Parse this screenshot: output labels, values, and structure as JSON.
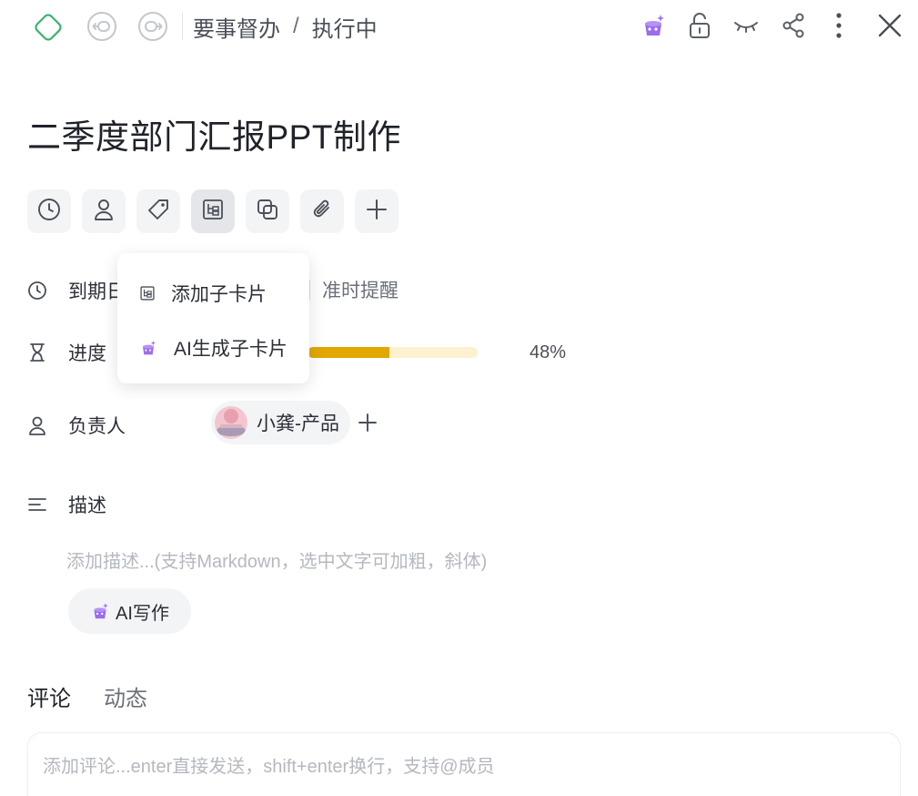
{
  "header": {
    "breadcrumb_parent": "要事督办",
    "breadcrumb_sep": "/",
    "breadcrumb_current": "执行中",
    "icons": [
      "diamond-icon",
      "back-icon",
      "forward-icon",
      "ai-wand-icon",
      "unlock-icon",
      "eye-closed-icon",
      "share-icon",
      "more-icon",
      "close-icon"
    ]
  },
  "task": {
    "title": "二季度部门汇报PPT制作"
  },
  "toolbar": {
    "icons": [
      "clock-icon",
      "user-icon",
      "tag-icon",
      "subcard-icon",
      "copy-icon",
      "attachment-icon",
      "plus-icon"
    ]
  },
  "properties": {
    "due_label": "到期日",
    "remind_label": "准时提醒",
    "progress_label": "进度",
    "progress_value": 48,
    "progress_text": "48%",
    "assignee_label": "负责人",
    "assignee_name": "小龚-产品"
  },
  "description": {
    "label": "描述",
    "placeholder": "添加描述...(支持Markdown，选中文字可加粗，斜体)",
    "ai_button": "AI写作"
  },
  "tabs": [
    "评论",
    "动态"
  ],
  "comment": {
    "placeholder": "添加评论...enter直接发送，shift+enter换行，支持@成员"
  },
  "popup": {
    "items": [
      {
        "label": "添加子卡片",
        "icon": "subcard-icon"
      },
      {
        "label": "AI生成子卡片",
        "icon": "ai-wand-icon"
      }
    ]
  },
  "colors": {
    "accent": "#8b5cf6",
    "progress": "#e0a800",
    "progress_track": "#fdf1cf",
    "logo": "#3cb371"
  }
}
